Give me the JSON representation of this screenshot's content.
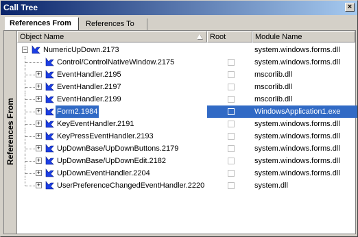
{
  "window": {
    "title": "Call Tree",
    "close_glyph": "×"
  },
  "tabs": [
    {
      "label": "References From",
      "active": true
    },
    {
      "label": "References To",
      "active": false
    }
  ],
  "sidebar": {
    "label": "References From"
  },
  "columns": {
    "name": "Object Name",
    "root": "Root",
    "module": "Module Name"
  },
  "colors": {
    "selection": "#316ac5",
    "icon_blue": "#1c3fe6",
    "title_start": "#0a246a"
  },
  "rows": [
    {
      "label": "NumericUpDown.2173",
      "module": "system.windows.forms.dll",
      "level": 0,
      "expander": "minus",
      "selected": false
    },
    {
      "label": "Control/ControlNativeWindow.2175",
      "module": "system.windows.forms.dll",
      "level": 1,
      "expander": "none",
      "selected": false
    },
    {
      "label": "EventHandler.2195",
      "module": "mscorlib.dll",
      "level": 1,
      "expander": "plus",
      "selected": false
    },
    {
      "label": "EventHandler.2197",
      "module": "mscorlib.dll",
      "level": 1,
      "expander": "plus",
      "selected": false
    },
    {
      "label": "EventHandler.2199",
      "module": "mscorlib.dll",
      "level": 1,
      "expander": "plus",
      "selected": false
    },
    {
      "label": "Form2.1984",
      "module": "WindowsApplication1.exe",
      "level": 1,
      "expander": "plus",
      "selected": true
    },
    {
      "label": "KeyEventHandler.2191",
      "module": "system.windows.forms.dll",
      "level": 1,
      "expander": "plus",
      "selected": false
    },
    {
      "label": "KeyPressEventHandler.2193",
      "module": "system.windows.forms.dll",
      "level": 1,
      "expander": "plus",
      "selected": false
    },
    {
      "label": "UpDownBase/UpDownButtons.2179",
      "module": "system.windows.forms.dll",
      "level": 1,
      "expander": "plus",
      "selected": false
    },
    {
      "label": "UpDownBase/UpDownEdit.2182",
      "module": "system.windows.forms.dll",
      "level": 1,
      "expander": "plus",
      "selected": false
    },
    {
      "label": "UpDownEventHandler.2204",
      "module": "system.windows.forms.dll",
      "level": 1,
      "expander": "plus",
      "selected": false
    },
    {
      "label": "UserPreferenceChangedEventHandler.2220",
      "module": "system.dll",
      "level": 1,
      "expander": "plus",
      "selected": false
    }
  ]
}
